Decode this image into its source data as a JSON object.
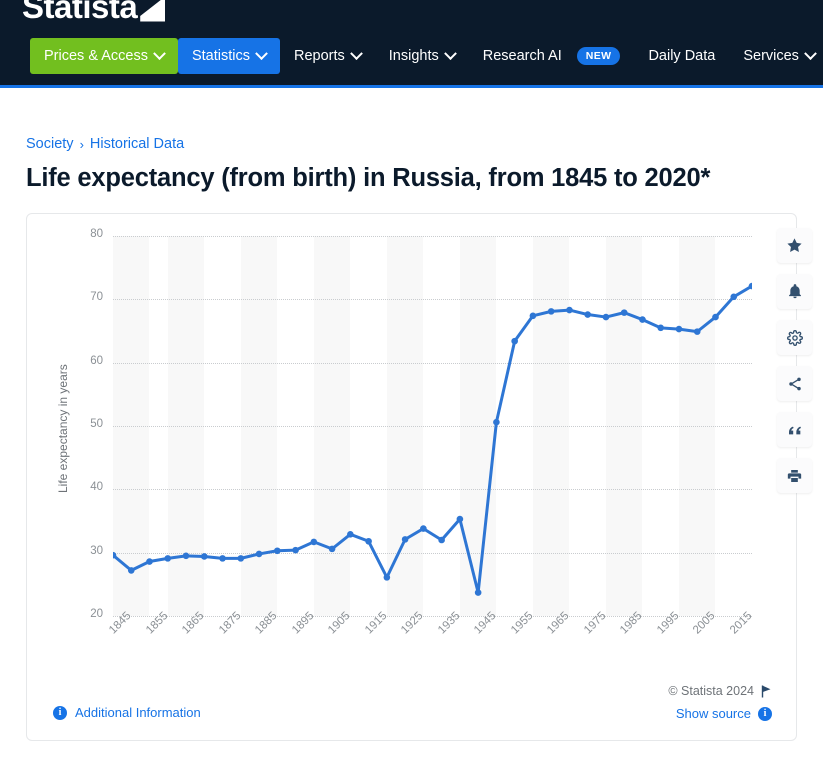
{
  "brand": {
    "logo_text": "Statista",
    "logo_mark": "statista-logo-mark",
    "accent_blue": "#1673e6",
    "accent_green": "#72bf1f",
    "dark_navy": "#0b1a2b"
  },
  "nav": {
    "items": [
      {
        "label": "Prices & Access",
        "style": "green",
        "caret": true,
        "badge": null
      },
      {
        "label": "Statistics",
        "style": "blue",
        "caret": true,
        "badge": null
      },
      {
        "label": "Reports",
        "style": "plain",
        "caret": true,
        "badge": null
      },
      {
        "label": "Insights",
        "style": "plain",
        "caret": true,
        "badge": null
      },
      {
        "label": "Research AI",
        "style": "plain",
        "caret": false,
        "badge": "NEW"
      },
      {
        "label": "Daily Data",
        "style": "plain",
        "caret": false,
        "badge": null
      },
      {
        "label": "Services",
        "style": "plain",
        "caret": true,
        "badge": null
      }
    ]
  },
  "breadcrumb": {
    "items": [
      "Society",
      "Historical Data"
    ],
    "separator": "›"
  },
  "page": {
    "title": "Life expectancy (from birth) in Russia, from 1845 to 2020*"
  },
  "rail": {
    "buttons": [
      {
        "name": "favorite-star-icon",
        "label": "Add to favorites"
      },
      {
        "name": "notification-bell-icon",
        "label": "Set notification"
      },
      {
        "name": "settings-gear-icon",
        "label": "Settings"
      },
      {
        "name": "share-icon",
        "label": "Share"
      },
      {
        "name": "citation-quote-icon",
        "label": "Citation"
      },
      {
        "name": "print-icon",
        "label": "Print"
      }
    ]
  },
  "card_footer": {
    "additional_information": "Additional Information",
    "copyright": "© Statista 2024",
    "show_source": "Show source"
  },
  "chart_data": {
    "type": "line",
    "title": "Life expectancy (from birth) in Russia, from 1845 to 2020*",
    "xlabel": "",
    "ylabel": "Life expectancy in years",
    "ylim": [
      20,
      80
    ],
    "yticks": [
      20,
      30,
      40,
      50,
      60,
      70,
      80
    ],
    "xlim": [
      1845,
      2020
    ],
    "xticks": [
      1845,
      1855,
      1865,
      1875,
      1885,
      1895,
      1905,
      1915,
      1925,
      1935,
      1945,
      1955,
      1965,
      1975,
      1985,
      1995,
      2005,
      2015
    ],
    "grid": true,
    "legend": false,
    "marker": "circle",
    "line_color": "#2e76d4",
    "series": [
      {
        "name": "Life expectancy in years",
        "x": [
          1845,
          1850,
          1855,
          1860,
          1865,
          1870,
          1875,
          1880,
          1885,
          1890,
          1895,
          1900,
          1905,
          1910,
          1915,
          1920,
          1925,
          1930,
          1935,
          1940,
          1945,
          1950,
          1955,
          1960,
          1965,
          1970,
          1975,
          1980,
          1985,
          1990,
          1995,
          2000,
          2005,
          2010,
          2015,
          2020
        ],
        "values": [
          29.6,
          27.2,
          28.6,
          29.1,
          29.5,
          29.4,
          29.1,
          29.1,
          29.8,
          30.3,
          30.4,
          31.7,
          30.6,
          32.9,
          31.8,
          26.1,
          32.1,
          33.8,
          32.0,
          35.3,
          23.7,
          50.6,
          63.4,
          67.4,
          68.1,
          68.3,
          67.6,
          67.2,
          67.9,
          66.8,
          65.5,
          65.3,
          64.9,
          67.2,
          70.4,
          72.1
        ]
      }
    ]
  }
}
